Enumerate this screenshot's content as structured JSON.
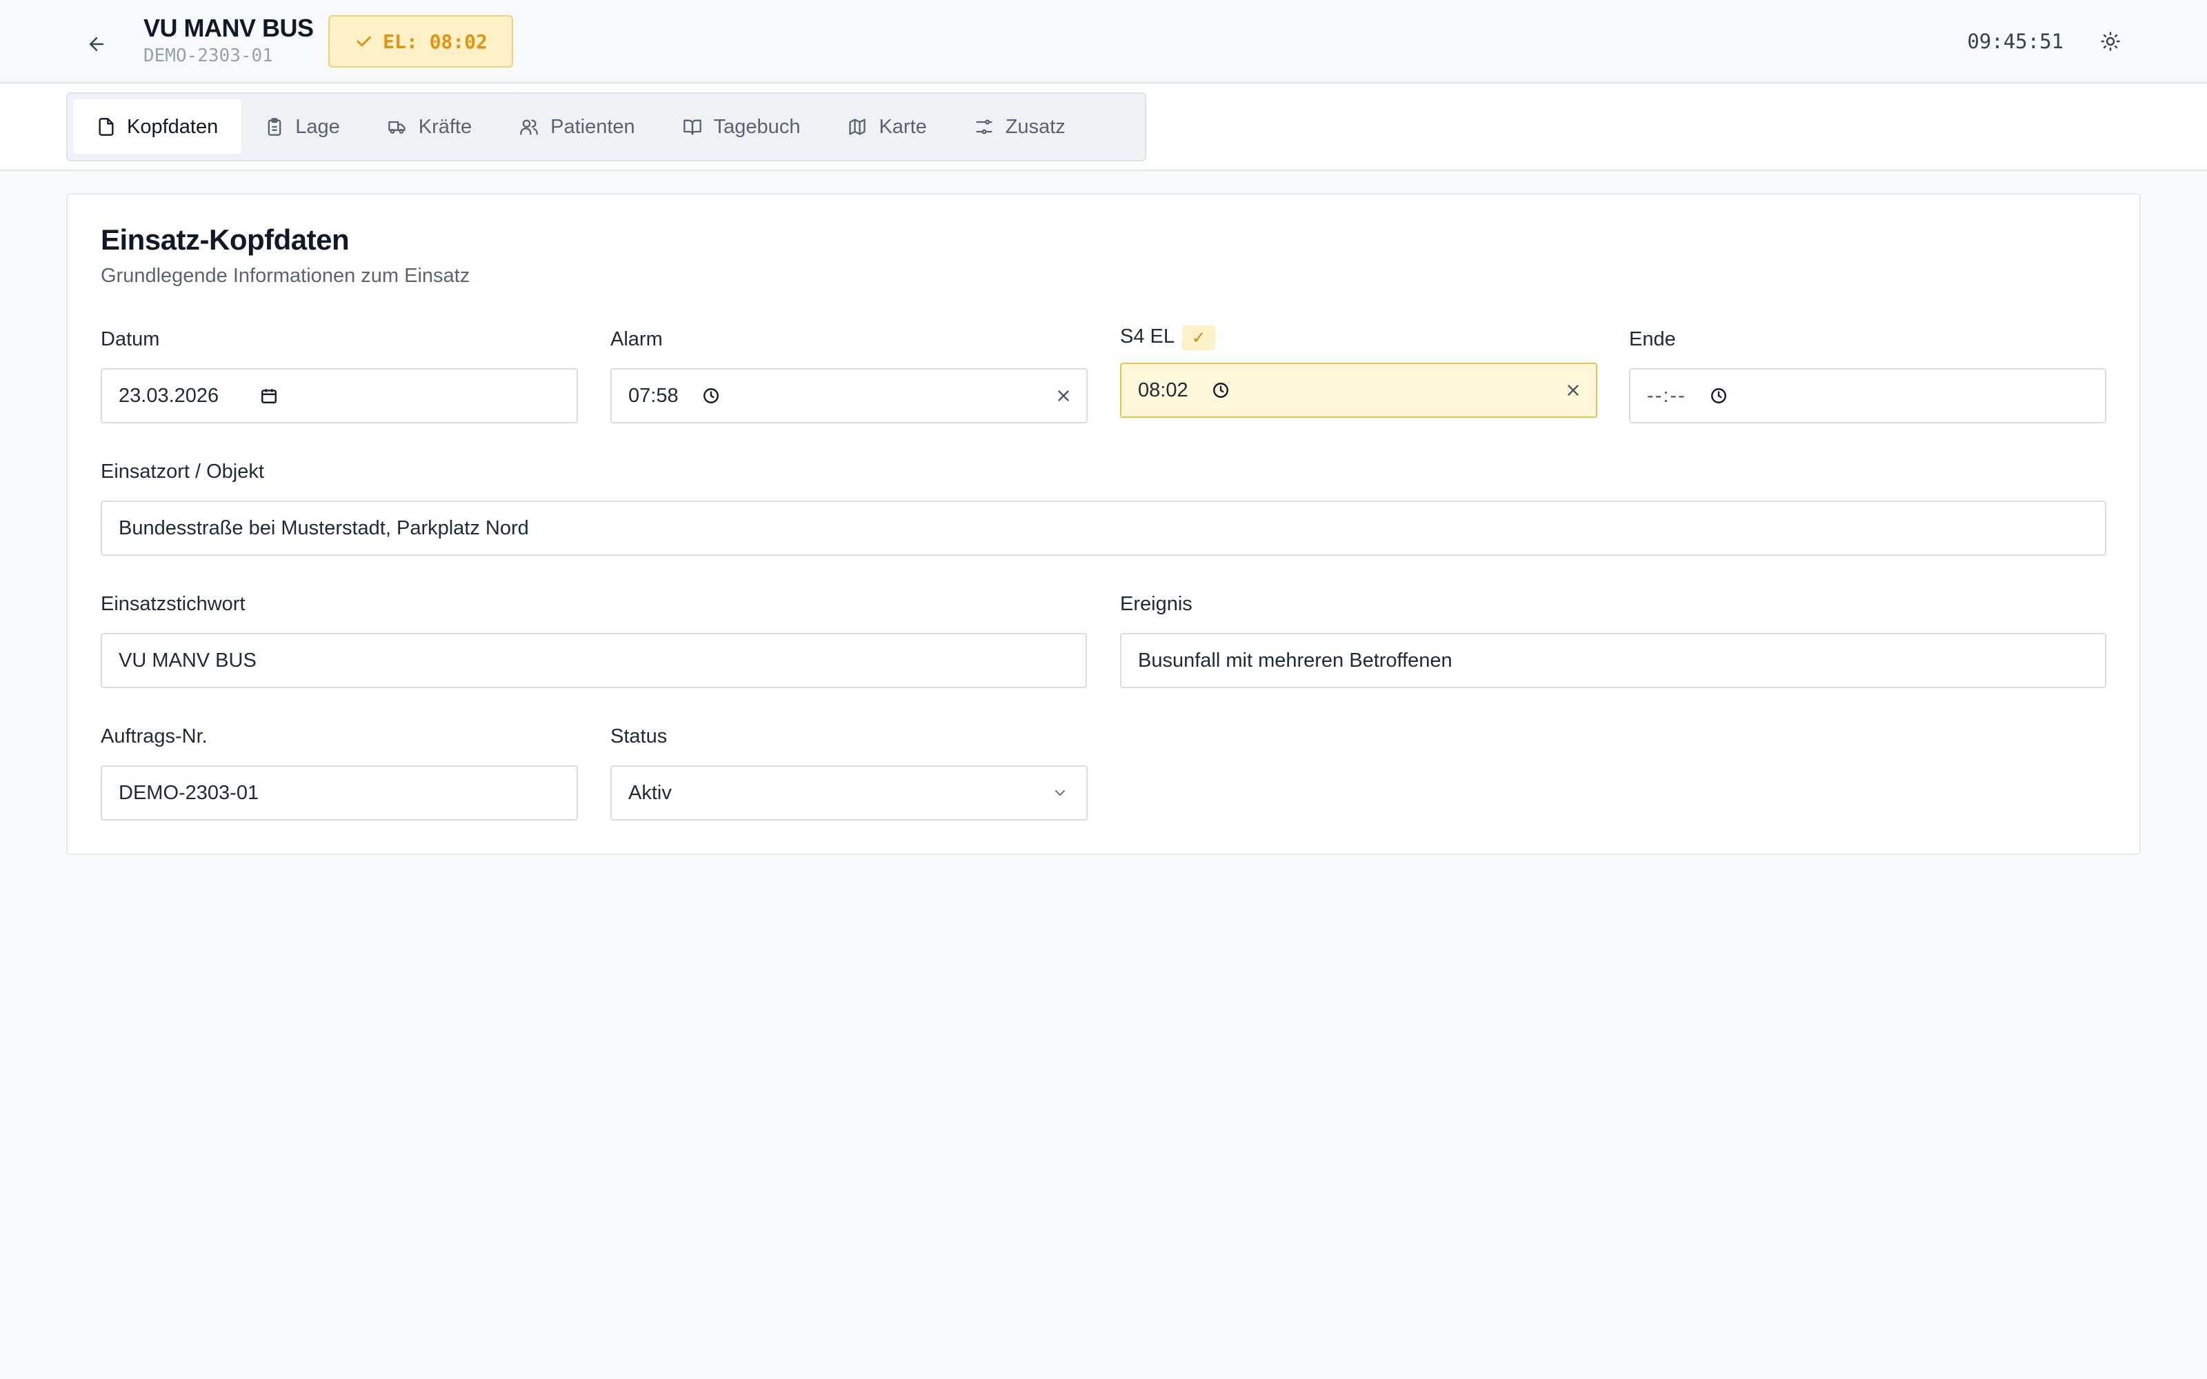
{
  "header": {
    "title": "VU MANV BUS",
    "subtitle": "DEMO-2303-01",
    "el_badge": "EL: 08:02",
    "clock": "09:45:51"
  },
  "tabs": [
    {
      "label": "Kopfdaten",
      "icon": "file-icon",
      "active": true
    },
    {
      "label": "Lage",
      "icon": "clipboard-icon",
      "active": false
    },
    {
      "label": "Kräfte",
      "icon": "truck-icon",
      "active": false
    },
    {
      "label": "Patienten",
      "icon": "users-icon",
      "active": false
    },
    {
      "label": "Tagebuch",
      "icon": "book-icon",
      "active": false
    },
    {
      "label": "Karte",
      "icon": "map-icon",
      "active": false
    },
    {
      "label": "Zusatz",
      "icon": "sliders-icon",
      "active": false
    }
  ],
  "card": {
    "title": "Einsatz-Kopfdaten",
    "description": "Grundlegende Informationen zum Einsatz"
  },
  "fields": {
    "datum": {
      "label": "Datum",
      "value": "23.03.2026"
    },
    "alarm": {
      "label": "Alarm",
      "value": "07:58"
    },
    "s4el": {
      "label": "S4 EL",
      "value": "08:02",
      "badge": "✓"
    },
    "ende": {
      "label": "Ende",
      "placeholder": "--:--"
    },
    "einsatzort": {
      "label": "Einsatzort / Objekt",
      "value": "Bundesstraße bei Musterstadt, Parkplatz Nord"
    },
    "stichwort": {
      "label": "Einsatzstichwort",
      "value": "VU MANV BUS"
    },
    "ereignis": {
      "label": "Ereignis",
      "value": "Busunfall mit mehreren Betroffenen"
    },
    "auftrag": {
      "label": "Auftrags-Nr.",
      "value": "DEMO-2303-01"
    },
    "status": {
      "label": "Status",
      "value": "Aktiv"
    }
  },
  "colors": {
    "accent_bg": "#fdf1c8",
    "accent_text": "#e3930f",
    "highlight_field": "#fef7da"
  }
}
